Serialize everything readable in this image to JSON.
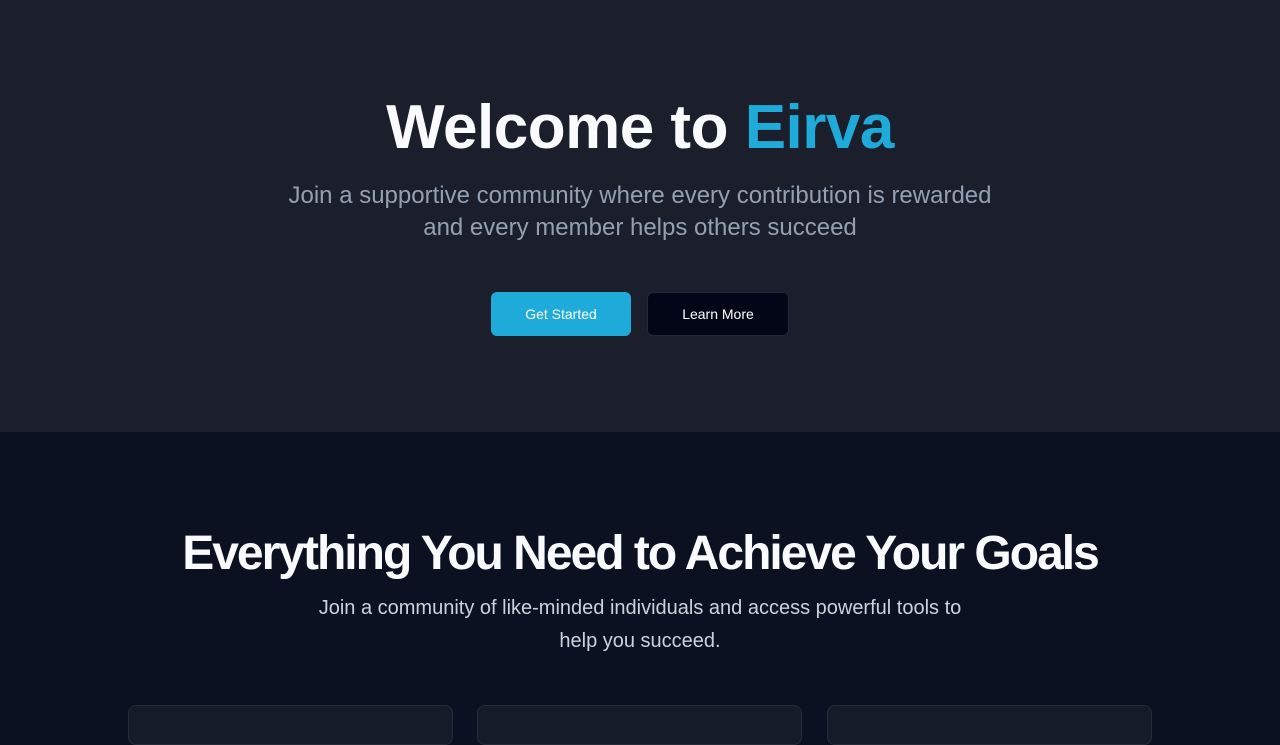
{
  "hero": {
    "title_prefix": "Welcome to ",
    "title_brand": "Eirva",
    "subtitle_line1": "Join a supportive community where every contribution is rewarded",
    "subtitle_line2": "and every member helps others succeed",
    "primary_button": "Get Started",
    "secondary_button": "Learn More"
  },
  "features": {
    "title": "Everything You Need to Achieve Your Goals",
    "subtitle_line1": "Join a community of like-minded individuals and access powerful tools to",
    "subtitle_line2": "help you succeed."
  },
  "colors": {
    "hero_background": "#1b1f2c",
    "features_background": "#0b1120",
    "brand_accent": "#1fabda",
    "secondary_button": "#020617"
  }
}
